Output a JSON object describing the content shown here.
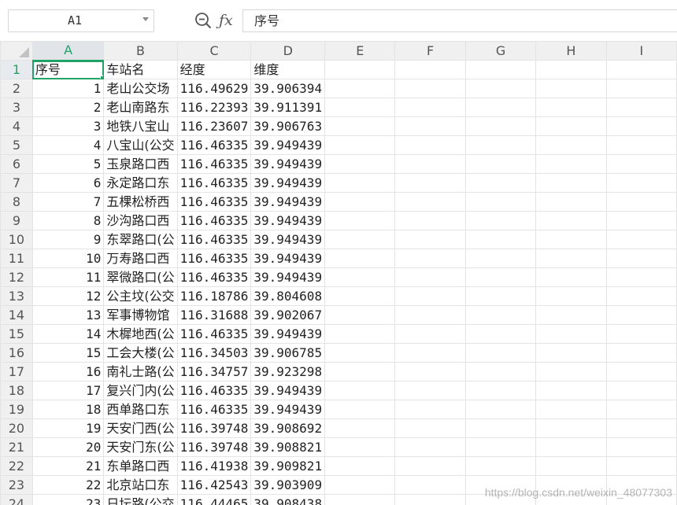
{
  "name_box": {
    "value": "A1"
  },
  "formula_bar": {
    "value": "序号"
  },
  "columns": [
    "A",
    "B",
    "C",
    "D",
    "E",
    "F",
    "G",
    "H",
    "I"
  ],
  "selected_column": "A",
  "selected_row": "1",
  "rows": [
    {
      "row": "1",
      "cells": [
        "序号",
        "车站名",
        "经度",
        "维度"
      ]
    },
    {
      "row": "2",
      "cells": [
        "1",
        "老山公交场",
        "116.49629",
        "39.906394"
      ]
    },
    {
      "row": "3",
      "cells": [
        "2",
        "老山南路东",
        "116.22393",
        "39.911391"
      ]
    },
    {
      "row": "4",
      "cells": [
        "3",
        "地铁八宝山",
        "116.23607",
        "39.906763"
      ]
    },
    {
      "row": "5",
      "cells": [
        "4",
        "八宝山(公交",
        "116.46335",
        "39.949439"
      ]
    },
    {
      "row": "6",
      "cells": [
        "5",
        "玉泉路口西",
        "116.46335",
        "39.949439"
      ]
    },
    {
      "row": "7",
      "cells": [
        "6",
        "永定路口东",
        "116.46335",
        "39.949439"
      ]
    },
    {
      "row": "8",
      "cells": [
        "7",
        "五棵松桥西",
        "116.46335",
        "39.949439"
      ]
    },
    {
      "row": "9",
      "cells": [
        "8",
        "沙沟路口西",
        "116.46335",
        "39.949439"
      ]
    },
    {
      "row": "10",
      "cells": [
        "9",
        "东翠路口(公",
        "116.46335",
        "39.949439"
      ]
    },
    {
      "row": "11",
      "cells": [
        "10",
        "万寿路口西",
        "116.46335",
        "39.949439"
      ]
    },
    {
      "row": "12",
      "cells": [
        "11",
        "翠微路口(公",
        "116.46335",
        "39.949439"
      ]
    },
    {
      "row": "13",
      "cells": [
        "12",
        "公主坟(公交",
        "116.18786",
        "39.804608"
      ]
    },
    {
      "row": "14",
      "cells": [
        "13",
        "军事博物馆",
        "116.31688",
        "39.902067"
      ]
    },
    {
      "row": "15",
      "cells": [
        "14",
        "木樨地西(公",
        "116.46335",
        "39.949439"
      ]
    },
    {
      "row": "16",
      "cells": [
        "15",
        "工会大楼(公",
        "116.34503",
        "39.906785"
      ]
    },
    {
      "row": "17",
      "cells": [
        "16",
        "南礼士路(公",
        "116.34757",
        "39.923298"
      ]
    },
    {
      "row": "18",
      "cells": [
        "17",
        "复兴门内(公",
        "116.46335",
        "39.949439"
      ]
    },
    {
      "row": "19",
      "cells": [
        "18",
        "西单路口东",
        "116.46335",
        "39.949439"
      ]
    },
    {
      "row": "20",
      "cells": [
        "19",
        "天安门西(公",
        "116.39748",
        "39.908692"
      ]
    },
    {
      "row": "21",
      "cells": [
        "20",
        "天安门东(公",
        "116.39748",
        "39.908821"
      ]
    },
    {
      "row": "22",
      "cells": [
        "21",
        "东单路口西",
        "116.41938",
        "39.909821"
      ]
    },
    {
      "row": "23",
      "cells": [
        "22",
        "北京站口东",
        "116.42543",
        "39.903909"
      ]
    },
    {
      "row": "24",
      "cells": [
        "23",
        "日坛路(公交",
        "116.44465",
        "39.908438"
      ]
    }
  ],
  "watermark": "https://blog.csdn.net/weixin_48077303"
}
